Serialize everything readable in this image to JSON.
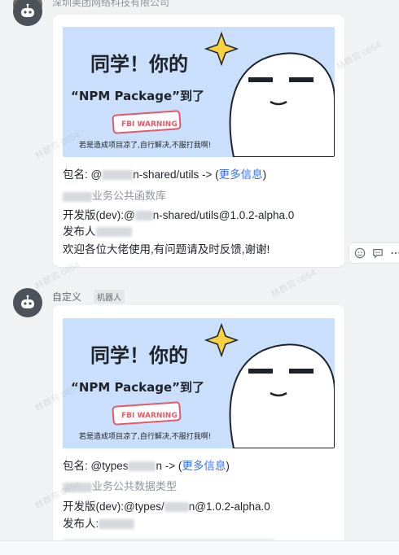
{
  "top": {
    "company_name": "深圳美团网络科技有限公司"
  },
  "message1": {
    "banner": {
      "headline_line1": "同学！你的",
      "headline_line2": "“NPM Package”到了",
      "stamp": "FBI WARNING",
      "subline": "若是造成项目凉了,自行解决,不服打我啊!"
    },
    "pkg_prefix": "包名: @",
    "pkg_suffix": "n-shared/utils -> (",
    "more_link": "更多信息",
    "pkg_close": ")",
    "desc_suffix": "业务公共函数库",
    "dev_prefix": "开发版(dev):@",
    "dev_suffix": "n-shared/utils@1.0.2-alpha.0",
    "publisher": "发布人",
    "welcome": "欢迎各位大佬使用,有问题请及时反馈,谢谢!"
  },
  "message2": {
    "sender": "自定义",
    "tag": "机器人",
    "banner": {
      "headline_line1": "同学！你的",
      "headline_line2": "“NPM Package”到了",
      "stamp": "FBI WARNING",
      "subline": "若是造成项目凉了,自行解决,不服打我啊!"
    },
    "pkg_prefix": "包名: @types",
    "pkg_suffix": "n -> (",
    "more_link": "更多信息",
    "pkg_close": ")",
    "desc_suffix": "业务公共数据类型",
    "dev_prefix": "开发版(dev):@types/",
    "dev_suffix": "n@1.0.2-alpha.0",
    "publisher": "发布人:"
  },
  "actions": {
    "emoji": "emoji-icon",
    "reply": "reply-icon",
    "more": "more-icon"
  },
  "watermark": "林群宾 0654",
  "colors": {
    "link": "#3370ff",
    "banner_bg": "#c9dffb",
    "page_bg": "#f1f2f4"
  }
}
